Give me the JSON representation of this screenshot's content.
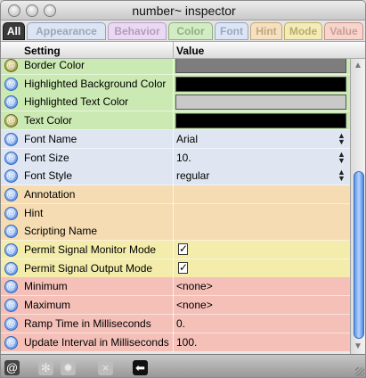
{
  "window": {
    "title": "number~ inspector"
  },
  "tabs": [
    {
      "label": "All",
      "bg": "#3a3a3a",
      "fg": "#ffffff",
      "border": "#1a1a1a"
    },
    {
      "label": "Appearance",
      "bg": "#dde5f3",
      "fg": "#9aa6bd",
      "border": "#8fa3c4"
    },
    {
      "label": "Behavior",
      "bg": "#ead9f3",
      "fg": "#b39bc0",
      "border": "#b79ec9"
    },
    {
      "label": "Color",
      "bg": "#d3ecc5",
      "fg": "#8eb07c",
      "border": "#8cb07a"
    },
    {
      "label": "Font",
      "bg": "#dde5f4",
      "fg": "#97a8c4",
      "border": "#93a5c6"
    },
    {
      "label": "Hint",
      "bg": "#f5e0c2",
      "fg": "#c3a57a",
      "border": "#c6a773"
    },
    {
      "label": "Mode",
      "bg": "#f3ecb8",
      "fg": "#b9ad68",
      "border": "#bfb064"
    },
    {
      "label": "Value",
      "bg": "#f7d4cc",
      "fg": "#cc9d92",
      "border": "#c99386"
    }
  ],
  "columns": {
    "setting": "Setting",
    "value": "Value"
  },
  "colors": {
    "color_group": "#cbeab3",
    "font_group": "#dfe6f2",
    "hint_group": "#f6dcb2",
    "mode_group": "#f3ecab",
    "value_group": "#f4c0b8"
  },
  "rows": [
    {
      "label": "Border Color",
      "icon": "olive",
      "group": "color_group",
      "swatch": "#7d7d7d"
    },
    {
      "label": "Highlighted Background Color",
      "icon": "blue",
      "group": "color_group",
      "swatch": "#000000"
    },
    {
      "label": "Highlighted Text Color",
      "icon": "blue",
      "group": "color_group",
      "swatch": "#c9c9c9"
    },
    {
      "label": "Text Color",
      "icon": "olive",
      "group": "color_group",
      "swatch": "#000000"
    },
    {
      "label": "Font Name",
      "icon": "blue",
      "group": "font_group",
      "value": "Arial",
      "stepper": true
    },
    {
      "label": "Font Size",
      "icon": "blue",
      "group": "font_group",
      "value": "10.",
      "stepper": true
    },
    {
      "label": "Font Style",
      "icon": "blue",
      "group": "font_group",
      "value": "regular",
      "stepper": true
    },
    {
      "label": "Annotation",
      "icon": "blue",
      "group": "hint_group",
      "value": ""
    },
    {
      "label": "Hint",
      "icon": "blue",
      "group": "hint_group",
      "value": ""
    },
    {
      "label": "Scripting Name",
      "icon": "blue",
      "group": "hint_group",
      "value": ""
    },
    {
      "label": "Permit Signal Monitor Mode",
      "icon": "blue",
      "group": "mode_group",
      "check": true
    },
    {
      "label": "Permit Signal Output Mode",
      "icon": "blue",
      "group": "mode_group",
      "check": true
    },
    {
      "label": "Minimum",
      "icon": "blue",
      "group": "value_group",
      "value": "<none>"
    },
    {
      "label": "Maximum",
      "icon": "blue",
      "group": "value_group",
      "value": "<none>"
    },
    {
      "label": "Ramp Time in Milliseconds",
      "icon": "blue",
      "group": "value_group",
      "value": "0."
    },
    {
      "label": "Update Interval in Milliseconds",
      "icon": "blue",
      "group": "value_group",
      "value": "100."
    }
  ],
  "scroll": {
    "position": 0.7
  },
  "bottom_buttons": [
    {
      "name": "at-icon",
      "glyph": "@"
    },
    {
      "name": "asterisk-icon",
      "glyph": "✻"
    },
    {
      "name": "gear-icon",
      "glyph": "✹"
    },
    {
      "name": "close-icon",
      "glyph": "×"
    },
    {
      "name": "back-arrow-icon",
      "glyph": "⬅"
    }
  ]
}
